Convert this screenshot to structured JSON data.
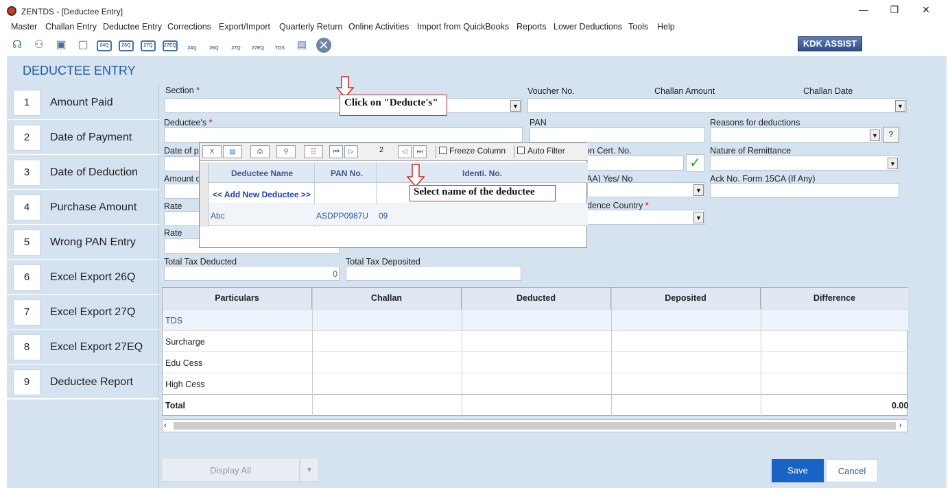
{
  "window": {
    "title": "ZENTDS - [Deductee Entry]",
    "minimize": "—",
    "restore": "❐",
    "close": "✕"
  },
  "menu": [
    "Master",
    "Challan Entry",
    "Deductee Entry",
    "Corrections",
    "Export/Import",
    "Quarterly Return",
    "Online Activities",
    "Import from QuickBooks",
    "Reports",
    "Lower Deductions",
    "Tools",
    "Help"
  ],
  "toolbar": {
    "icons": [
      "24Q",
      "26Q",
      "27Q",
      "27EQ",
      "24Q",
      "26Q",
      "27Q",
      "27EQ",
      "TDS"
    ],
    "kdk_label": "KDK ASSIST"
  },
  "page": {
    "title": "DEDUCTEE ENTRY"
  },
  "sidebar": {
    "items": [
      {
        "num": "1",
        "label": "Amount Paid"
      },
      {
        "num": "2",
        "label": "Date of Payment"
      },
      {
        "num": "3",
        "label": "Date of Deduction"
      },
      {
        "num": "4",
        "label": "Purchase Amount"
      },
      {
        "num": "5",
        "label": "Wrong PAN Entry"
      },
      {
        "num": "6",
        "label": "Excel Export 26Q"
      },
      {
        "num": "7",
        "label": "Excel Export 27Q"
      },
      {
        "num": "8",
        "label": "Excel Export 27EQ"
      },
      {
        "num": "9",
        "label": "Deductee Report"
      }
    ]
  },
  "form": {
    "section_label": "Section",
    "voucher_label": "Voucher No.",
    "challan_amount_label": "Challan Amount",
    "challan_date_label": "Challan Date",
    "deductee_label": "Deductee's",
    "pan_label": "PAN",
    "reasons_label": "Reasons for deductions",
    "help_btn": "?",
    "date_partial": "Date of p",
    "cert_partial": "on Cert. No.",
    "nature_label": "Nature of Remittance",
    "amount_partial": "Amount o",
    "aa_partial": "AA) Yes/ No",
    "ack_label": "Ack No. Form 15CA (If Any)",
    "rate1_label": "Rate",
    "residence_partial": "dence Country",
    "rate2_label": "Rate",
    "total_deducted_label": "Total Tax Deducted",
    "total_deducted_value": "0",
    "total_deposited_label": "Total Tax Deposited"
  },
  "popup": {
    "page_value": "2",
    "freeze_label": "Freeze Column",
    "filter_label": "Auto Filter",
    "columns": [
      "Deductee Name",
      "PAN No.",
      "Identi. No."
    ],
    "add_new": "<< Add New Deductee >>",
    "rows": [
      {
        "name": "Abc",
        "pan": "ASDPP0987U",
        "id": "09"
      }
    ]
  },
  "callouts": {
    "click": "Click on \"Deducte's\"",
    "select": "Select name of the deductee"
  },
  "table": {
    "headers": [
      "Particulars",
      "Challan",
      "Deducted",
      "Deposited",
      "Difference"
    ],
    "rows": [
      "TDS",
      "Surcharge",
      "Edu Cess",
      "High Cess",
      "Total"
    ],
    "total_difference": "0.00"
  },
  "buttons": {
    "display_all": "Display All",
    "save": "Save",
    "cancel": "Cancel"
  },
  "colors": {
    "accent": "#1f5ba8",
    "panel": "#d5e2f0",
    "save": "#1763c6"
  }
}
